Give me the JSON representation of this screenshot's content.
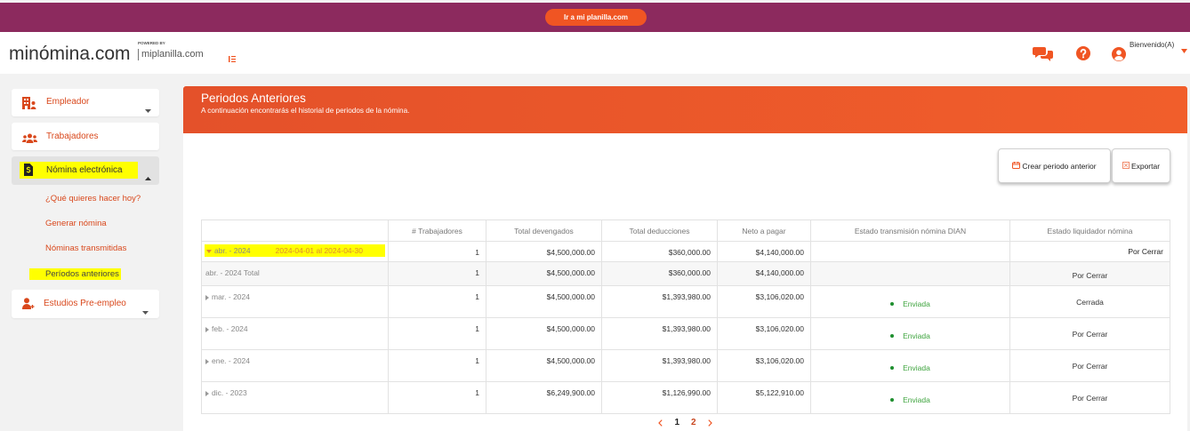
{
  "colors": {
    "brand_purple": "#8c2a5e",
    "accent": "#f05523",
    "sidebar_text": "#d9481c",
    "highlight": "#ffff00",
    "status_ok": "#1f8f2f",
    "status_pending": "#d0373b"
  },
  "topbar": {
    "cta_label": "Ir a mi planilla.com"
  },
  "header": {
    "logo": "minómina.com",
    "powered_by": "POWERED BY",
    "partner_logo": "miplanilla.com",
    "welcome": "Bienvenido(A)",
    "icons": [
      "menu-toggle-icon",
      "chat-icon",
      "help-icon",
      "user-avatar-icon",
      "caret-down-icon"
    ]
  },
  "sidebar": {
    "items": [
      {
        "label": "Empleador",
        "icon": "building-user-icon",
        "expanded": false
      },
      {
        "label": "Trabajadores",
        "icon": "users-icon"
      },
      {
        "label": "Nómina electrónica",
        "icon": "file-invoice-dollar-icon",
        "expanded": true,
        "children": [
          {
            "label": "¿Qué quieres hacer hoy?"
          },
          {
            "label": "Generar nómina"
          },
          {
            "label": "Nóminas transmitidas"
          },
          {
            "label": "Períodos anteriores",
            "active": true
          }
        ]
      },
      {
        "label": "Estudios Pre-empleo",
        "icon": "user-plus-icon",
        "expanded": false
      }
    ]
  },
  "page": {
    "title": "Periodos Anteriores",
    "subtitle": "A continuación encontrarás el historial de periodos de la nómina.",
    "actions": {
      "create": "Crear periodo anterior",
      "export": "Exportar"
    }
  },
  "table": {
    "columns": [
      "# Trabajadores",
      "Total devengados",
      "Total deducciones",
      "Neto a pagar",
      "Estado transmisión nómina DIAN",
      "Estado liquidador nómina"
    ],
    "rows": [
      {
        "period": "abr. - 2024",
        "range": "2024-04-01 al 2024-04-30",
        "expanded": true,
        "workers": "1",
        "devengados": "$4,500,000.00",
        "deducciones": "$360,000.00",
        "neto": "$4,140,000.00",
        "liquidador": "Por Cerrar"
      },
      {
        "period": "abr. - 2024 Total",
        "is_total": true,
        "workers": "1",
        "devengados": "$4,500,000.00",
        "deducciones": "$360,000.00",
        "neto": "$4,140,000.00",
        "liquidador": "Por Cerrar"
      },
      {
        "period": "mar. - 2024",
        "expanded": false,
        "workers": "1",
        "devengados": "$4,500,000.00",
        "deducciones": "$1,393,980.00",
        "neto": "$3,106,020.00",
        "dian": "Enviada",
        "liquidador": "Cerrada"
      },
      {
        "period": "feb. - 2024",
        "expanded": false,
        "workers": "1",
        "devengados": "$4,500,000.00",
        "deducciones": "$1,393,980.00",
        "neto": "$3,106,020.00",
        "dian": "Enviada",
        "liquidador": "Por Cerrar"
      },
      {
        "period": "ene. - 2024",
        "expanded": false,
        "workers": "1",
        "devengados": "$4,500,000.00",
        "deducciones": "$1,393,980.00",
        "neto": "$3,106,020.00",
        "dian": "Enviada",
        "liquidador": "Por Cerrar"
      },
      {
        "period": "dic. - 2023",
        "expanded": false,
        "workers": "1",
        "devengados": "$6,249,900.00",
        "deducciones": "$1,126,990.00",
        "neto": "$5,122,910.00",
        "dian": "Enviada",
        "liquidador": "Por Cerrar"
      }
    ]
  },
  "pagination": {
    "pages": [
      "1",
      "2"
    ],
    "current": 1
  }
}
